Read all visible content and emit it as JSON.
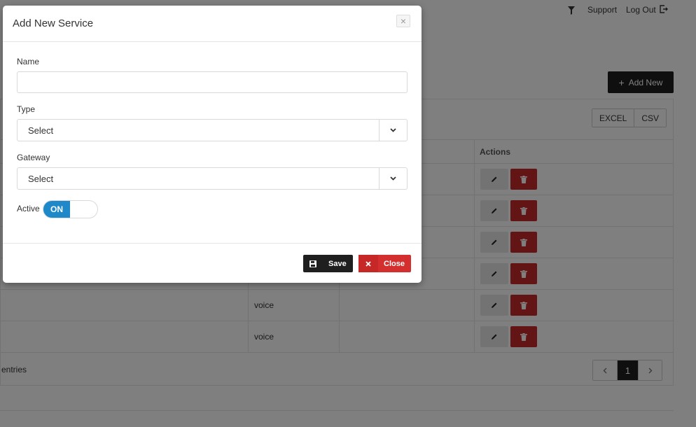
{
  "nav": {
    "support": "Support",
    "logout": "Log Out"
  },
  "toolbar": {
    "add_new": "Add New"
  },
  "export": {
    "excel": "EXCEL",
    "csv": "CSV"
  },
  "table": {
    "actions_header": "Actions",
    "rows": [
      {
        "type": ""
      },
      {
        "type": ""
      },
      {
        "type": ""
      },
      {
        "type": ""
      },
      {
        "type": "voice"
      },
      {
        "type": "voice"
      }
    ]
  },
  "footer": {
    "entries_text": "entries",
    "page_current": "1"
  },
  "modal": {
    "title": "Add New Service",
    "close_x": "×",
    "name_label": "Name",
    "name_value": "",
    "type_label": "Type",
    "type_value": "Select",
    "gateway_label": "Gateway",
    "gateway_value": "Select",
    "active_label": "Active",
    "active_toggle": "ON",
    "save_label": "Save",
    "close_label": "Close"
  },
  "colors": {
    "primary_dark": "#1f1f1f",
    "danger": "#d32f2f",
    "toggle_on": "#1e88c9"
  },
  "icons": {
    "filter": "filter-icon",
    "logout": "logout-icon",
    "plus": "plus-icon",
    "edit": "pencil-icon",
    "delete": "trash-icon",
    "save": "floppy-disk-icon",
    "close": "x-icon",
    "chevron": "chevron-down-icon"
  }
}
